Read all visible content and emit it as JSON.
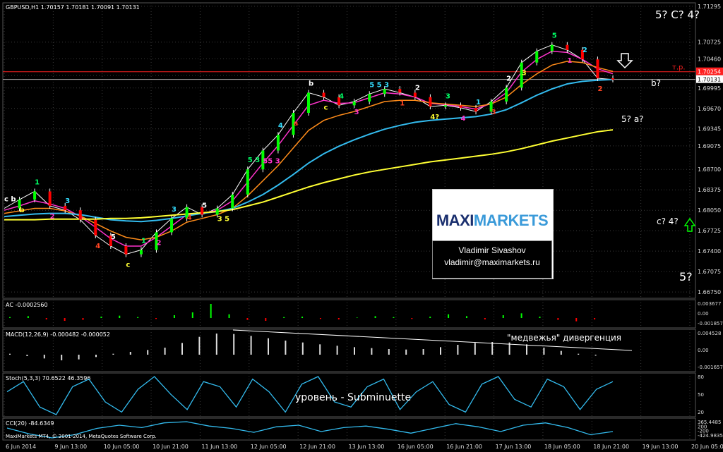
{
  "chart_data": {
    "type": "line",
    "symbol_header": "GBPUSD,H1  1.70157 1.70181 1.70091 1.70131",
    "y_ticks": [
      "1.71295",
      "1.70725",
      "1.70460",
      "1.70195",
      "1.69995",
      "1.69670",
      "1.69345",
      "1.69075",
      "1.68700",
      "1.68375",
      "1.68050",
      "1.67725",
      "1.67400",
      "1.67075",
      "1.66750"
    ],
    "x_ticks": [
      "6 Jun 2014",
      "9 Jun 13:00",
      "10 Jun 05:00",
      "10 Jun 21:00",
      "11 Jun 13:00",
      "12 Jun 05:00",
      "12 Jun 21:00",
      "13 Jun 13:00",
      "16 Jun 05:00",
      "16 Jun 21:00",
      "17 Jun 13:00",
      "18 Jun 05:00",
      "18 Jun 21:00",
      "19 Jun 13:00",
      "20 Jun 05:00"
    ],
    "ylim": [
      1.6665,
      1.7135
    ],
    "current_price": "1.70131",
    "target_price": "1.70254",
    "target_label": "т.р.",
    "series": [
      {
        "name": "price",
        "values": [
          1.6808,
          1.6822,
          1.6835,
          1.6812,
          1.6805,
          1.679,
          1.6765,
          1.6748,
          1.6735,
          1.6742,
          1.677,
          1.6792,
          1.681,
          1.6798,
          1.6808,
          1.683,
          1.687,
          1.69,
          1.6925,
          1.696,
          1.6992,
          1.6985,
          1.6972,
          1.6978,
          1.699,
          1.6998,
          1.6992,
          1.6985,
          1.697,
          1.6972,
          1.6968,
          1.6962,
          1.6978,
          1.7,
          1.704,
          1.7058,
          1.7068,
          1.706,
          1.7045,
          1.7015,
          1.7013
        ]
      },
      {
        "name": "ma_fast",
        "values": [
          1.6805,
          1.6812,
          1.682,
          1.6815,
          1.6808,
          1.6795,
          1.6778,
          1.676,
          1.6748,
          1.6748,
          1.6762,
          1.678,
          1.6798,
          1.68,
          1.6805,
          1.682,
          1.685,
          1.688,
          1.6908,
          1.694,
          1.6972,
          1.698,
          1.6975,
          1.6976,
          1.6984,
          1.6992,
          1.699,
          1.6985,
          1.6975,
          1.6973,
          1.697,
          1.6966,
          1.6975,
          1.6992,
          1.7025,
          1.7045,
          1.7058,
          1.7056,
          1.7045,
          1.703,
          1.7022
        ]
      },
      {
        "name": "ma_mid",
        "values": [
          1.68,
          1.6804,
          1.6808,
          1.6808,
          1.6804,
          1.6796,
          1.6784,
          1.6772,
          1.6762,
          1.6758,
          1.6762,
          1.6772,
          1.6786,
          1.6792,
          1.6798,
          1.6808,
          1.6828,
          1.6852,
          1.6876,
          1.6904,
          1.6932,
          1.6948,
          1.6956,
          1.6962,
          1.697,
          1.6978,
          1.698,
          1.698,
          1.6976,
          1.6974,
          1.6972,
          1.697,
          1.6974,
          1.6985,
          1.7005,
          1.7022,
          1.7036,
          1.7042,
          1.704,
          1.7032,
          1.7026
        ]
      },
      {
        "name": "ma_slow",
        "values": [
          1.6795,
          1.6797,
          1.6799,
          1.68,
          1.68,
          1.6798,
          1.6794,
          1.679,
          1.6788,
          1.6787,
          1.6789,
          1.6792,
          1.6796,
          1.68,
          1.6803,
          1.6808,
          1.6818,
          1.683,
          1.6845,
          1.6862,
          1.688,
          1.6895,
          1.6907,
          1.6917,
          1.6926,
          1.6934,
          1.694,
          1.6945,
          1.6948,
          1.695,
          1.6952,
          1.6954,
          1.6958,
          1.6965,
          1.6976,
          1.6988,
          1.6998,
          1.7006,
          1.701,
          1.7012,
          1.7013
        ]
      },
      {
        "name": "ma_long",
        "values": [
          1.679,
          1.679,
          1.679,
          1.6791,
          1.6791,
          1.6791,
          1.6791,
          1.6792,
          1.6792,
          1.6793,
          1.6795,
          1.6797,
          1.6799,
          1.6801,
          1.6803,
          1.6806,
          1.6812,
          1.6818,
          1.6826,
          1.6834,
          1.6842,
          1.6849,
          1.6855,
          1.6861,
          1.6866,
          1.687,
          1.6874,
          1.6878,
          1.6882,
          1.6885,
          1.6888,
          1.6891,
          1.6894,
          1.6898,
          1.6903,
          1.6909,
          1.6915,
          1.692,
          1.6925,
          1.693,
          1.6933
        ]
      }
    ],
    "wave_labels": [
      "c b",
      "b",
      "1",
      "2",
      "3",
      "4",
      "5",
      "c",
      "1",
      "2",
      "3",
      "4",
      "5",
      "3 5",
      "5 3",
      "55 3",
      "4",
      "a",
      "b",
      "c",
      "4",
      "3",
      "5 5 3",
      "1",
      "2",
      "4?",
      "3",
      "4",
      "1",
      "3",
      "2",
      "3",
      "5",
      "1",
      "2",
      "2"
    ],
    "forecast_labels": {
      "five_c_four": "5? C? 4?",
      "b_q": "b?",
      "five_a": "5? a?",
      "c_four": "c? 4?",
      "five": "5?"
    },
    "ac": {
      "label": "AC -0.0002560",
      "y_ticks": [
        "0.003677",
        "0.00",
        "-0.001857"
      ],
      "values": [
        0.0002,
        0.0004,
        -0.0003,
        -0.0006,
        -0.0004,
        0.0003,
        0.0005,
        0.0002,
        -0.0002,
        0.0006,
        0.0012,
        0.003,
        0.0008,
        -0.0004,
        -0.0006,
        0.0002,
        0.0003,
        -0.0002,
        -0.0003,
        0.0001,
        0.0004,
        0.0002,
        -0.0002,
        0.0003,
        0.0008,
        0.0004,
        -0.0003,
        0.0006,
        0.001,
        0.0003,
        -0.0004,
        -0.0007,
        -0.0003
      ]
    },
    "macd": {
      "label": "MACD(12,26,9) -0.000482 -0.000052",
      "y_ticks": [
        "0.004528",
        "0.00",
        "-0.001657"
      ],
      "divergence_text": "\"медвежья\" дивергенция",
      "values": [
        0.0002,
        -0.0003,
        -0.0008,
        -0.0012,
        -0.001,
        -0.0005,
        0.0002,
        0.0006,
        0.001,
        0.0015,
        0.0025,
        0.0038,
        0.0045,
        0.0044,
        0.004,
        0.0035,
        0.003,
        0.0026,
        0.0022,
        0.0019,
        0.0016,
        0.0014,
        0.0012,
        0.0011,
        0.0012,
        0.0016,
        0.0021,
        0.0025,
        0.0027,
        0.0026,
        0.0022,
        0.0015,
        0.0008,
        0.0002,
        -0.0002
      ]
    },
    "stoch": {
      "label": "Stoch(5,3,3) 70.6522 46.3596",
      "y_ticks": [
        "80",
        "50",
        "20"
      ],
      "level_text": "уровень - Subminuette",
      "values": [
        60,
        80,
        30,
        15,
        70,
        85,
        40,
        20,
        65,
        90,
        55,
        25,
        80,
        70,
        30,
        85,
        60,
        20,
        75,
        90,
        40,
        30,
        70,
        85,
        25,
        60,
        80,
        35,
        20,
        75,
        90,
        45,
        30,
        85,
        70,
        25,
        65,
        80
      ]
    },
    "cci": {
      "label": "CCI(20) -84.6349",
      "y_ticks": [
        "365.4485",
        "200",
        "-200",
        "-424.9835"
      ],
      "values": [
        50,
        -100,
        -200,
        -120,
        40,
        120,
        60,
        180,
        210,
        100,
        40,
        -60,
        80,
        120,
        -40,
        60,
        100,
        20,
        -80,
        40,
        160,
        80,
        -40,
        120,
        180,
        60,
        -120,
        -40
      ]
    }
  },
  "copyright": "MaxiMarkets MT4, © 2001-2014, MetaQuotes Software Corp.",
  "watermark": {
    "logo_left": "MAXI",
    "logo_right": "MARKETS",
    "name": "Vladimir Sivashov",
    "email": "vladimir@maximarkets.ru"
  },
  "colors": {
    "background": "#000000",
    "grid": "#3a3a3a",
    "ma_fast": "#ff33cc",
    "ma_mid": "#ff8c1a",
    "ma_slow": "#33bbee",
    "ma_long": "#ffff33",
    "target": "#ff2020",
    "bull": "#00ff00",
    "bear": "#ff0000"
  }
}
